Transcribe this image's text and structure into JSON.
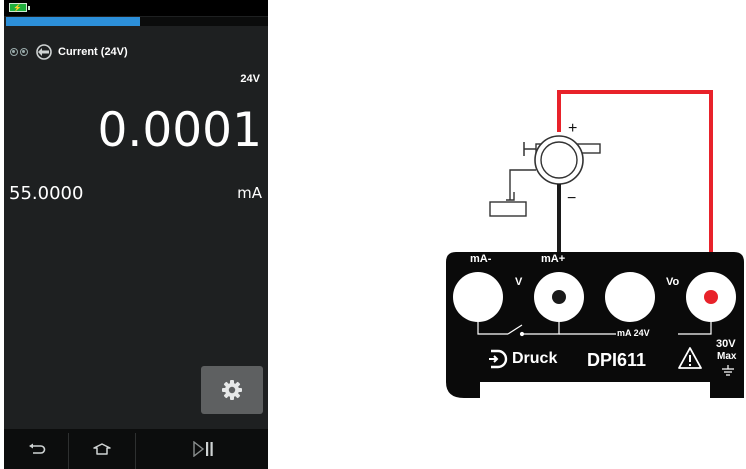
{
  "device": {
    "progress_fraction": 0.51,
    "function_label": "Current (24V)",
    "range_label": "24V",
    "main_reading": "0.0001",
    "secondary_reading": "55.0000",
    "secondary_unit": "mA",
    "icons": {
      "battery": "battery-icon",
      "channel": "channel-indicator-icon",
      "source": "current-source-icon",
      "settings": "gear-icon",
      "back": "back-arrow-icon",
      "home": "home-icon",
      "play_pause": "play-pause-icon"
    }
  },
  "wiring": {
    "terminals": {
      "ma_minus": "mA-",
      "ma_plus": "mA+",
      "v": "V",
      "vo": "Vo"
    },
    "bus_label": "mA 24V",
    "brand": "Druck",
    "model": "DPI611",
    "rating_top": "30V",
    "rating_bottom": "Max",
    "device_plus": "+",
    "device_minus": "−",
    "wire_color_positive": "#e8222a",
    "wire_color_negative": "#1a1a1a"
  }
}
